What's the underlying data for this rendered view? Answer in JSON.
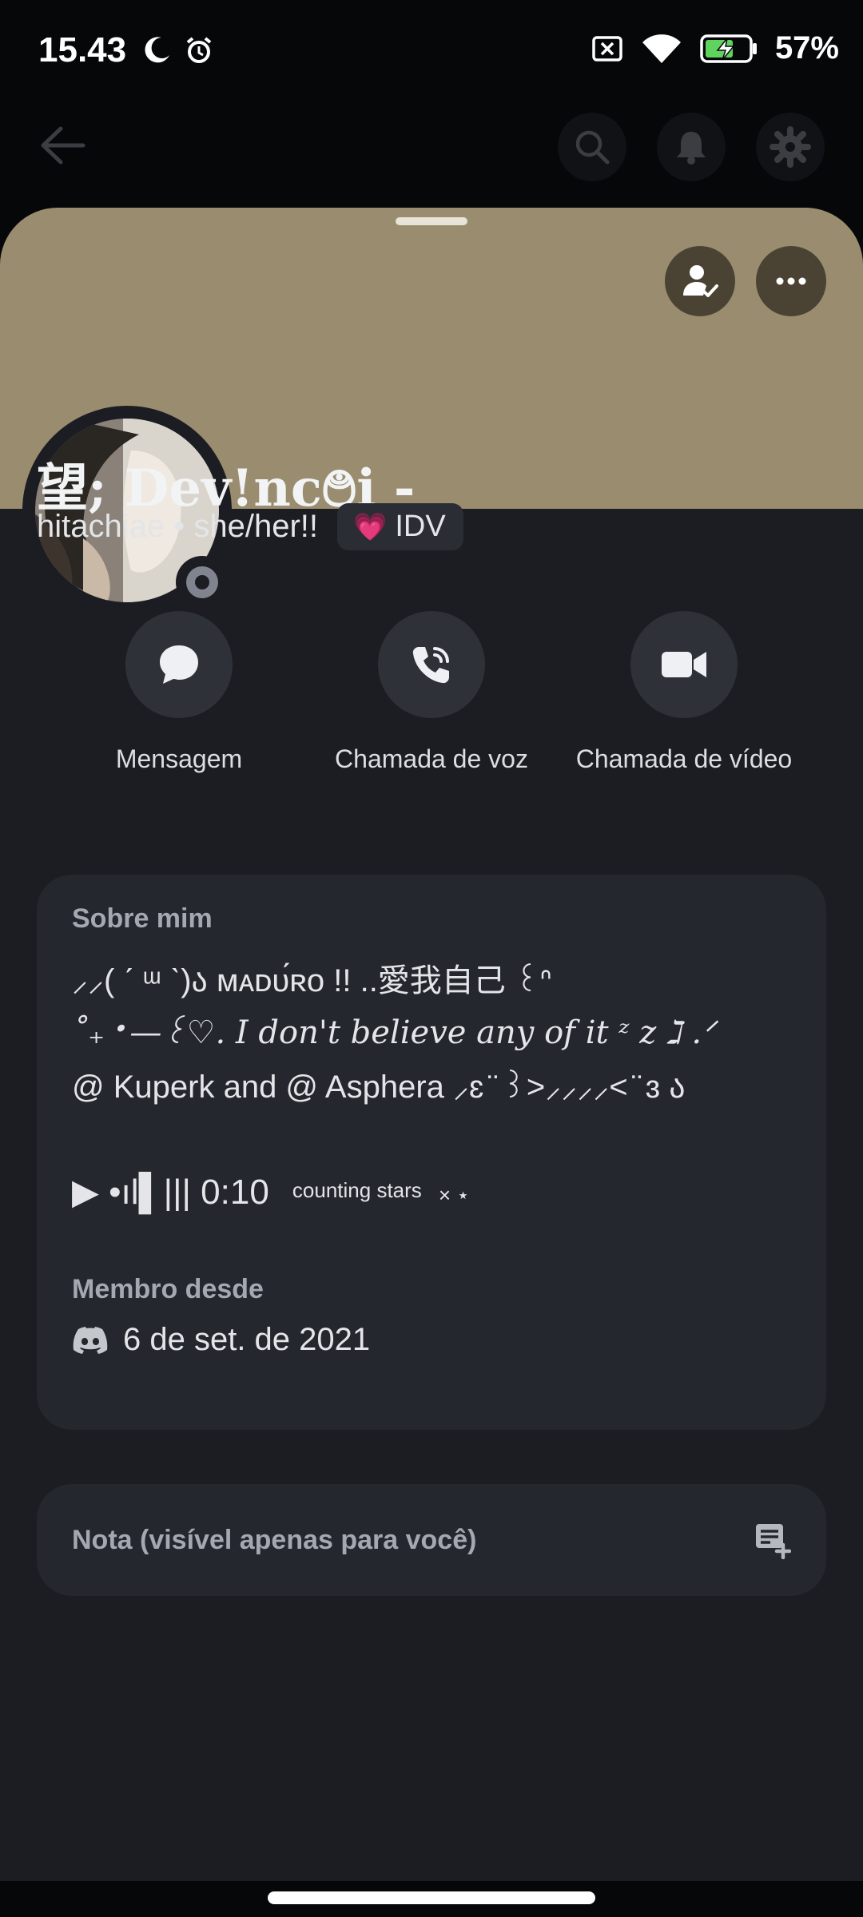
{
  "status_bar": {
    "time": "15.43",
    "battery": "57%"
  },
  "profile": {
    "display_name": "望; Dev!nc࿉i -",
    "username_line": "hitachiae • she/her!!",
    "tag": {
      "emoji": "💗",
      "label": "IDV"
    },
    "banner_color": "#9a8c6e"
  },
  "actions": [
    {
      "label": "Mensagem"
    },
    {
      "label": "Chamada de voz"
    },
    {
      "label": "Chamada de vídeo"
    }
  ],
  "about": {
    "title": "Sobre mim",
    "lines": [
      "⸝⸝( ˊ ᵚ ˋ)ა ᴍᴀᴅᴜ́ʀᴏ !! ..愛我自己 ꒰ᐢ",
      "˚₊‧—꒰♡. I don't believe any of it ᶻ z ℷ .ᐟ",
      "@ Kuperk and @ Asphera ⸝ɛ ̈ ꒱>⸝⸝⸝⸝< ̈ ɜ ა"
    ],
    "audio": {
      "prefix": "▶ •ıl▌||| 0:10",
      "track": "counting stars",
      "suffix": "× ⋆"
    }
  },
  "member_since": {
    "title": "Membro desde",
    "date": "6 de set. de 2021"
  },
  "note": {
    "placeholder": "Nota (visível apenas para você)"
  }
}
